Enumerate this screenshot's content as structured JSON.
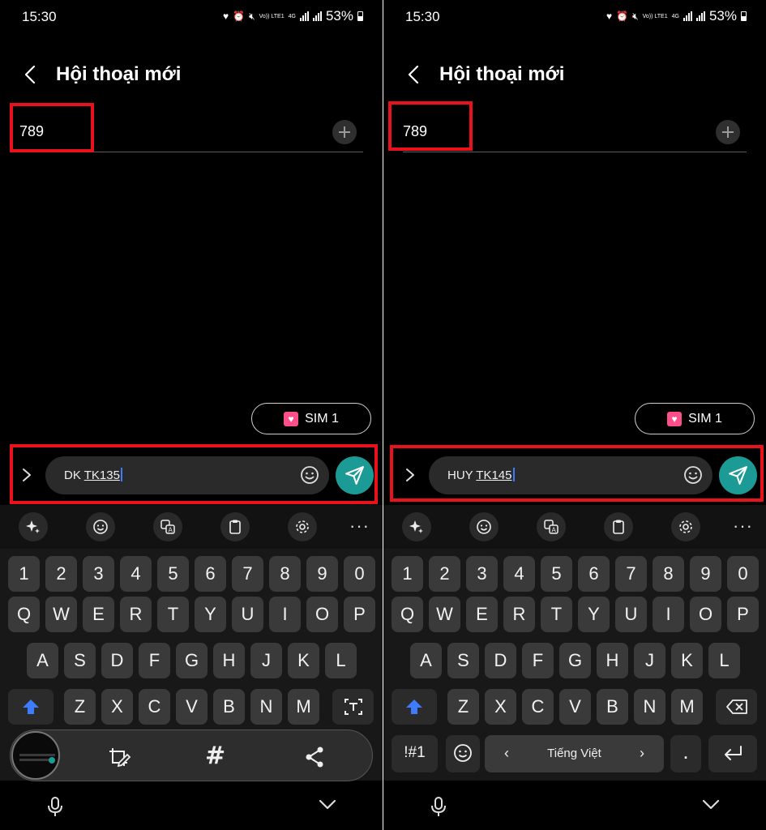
{
  "status": {
    "time": "15:30",
    "volte_label": "Vo)) LTE1",
    "net_label": "4G",
    "battery": "53%"
  },
  "header": {
    "title": "Hội thoại mới"
  },
  "left_screen": {
    "recipient": "789",
    "sim_label": "SIM 1",
    "message_prefix": "DK ",
    "message_word": "TK135"
  },
  "right_screen": {
    "recipient": "789",
    "sim_label": "SIM 1",
    "message_prefix": "HUY ",
    "message_word": "TK145"
  },
  "keyboard": {
    "numbers": [
      "1",
      "2",
      "3",
      "4",
      "5",
      "6",
      "7",
      "8",
      "9",
      "0"
    ],
    "row1": [
      "Q",
      "W",
      "E",
      "R",
      "T",
      "Y",
      "U",
      "I",
      "O",
      "P"
    ],
    "row2": [
      "A",
      "S",
      "D",
      "F",
      "G",
      "H",
      "J",
      "K",
      "L"
    ],
    "row3": [
      "Z",
      "X",
      "C",
      "V",
      "B",
      "N",
      "M"
    ],
    "symbols_label": "!#1",
    "language_label": "Tiếng Việt",
    "period_label": "."
  },
  "floating_toolbar": {
    "hash_label": "#"
  },
  "colors": {
    "highlight": "#e8111c",
    "send": "#1c9a96",
    "shift": "#3d7bff"
  }
}
